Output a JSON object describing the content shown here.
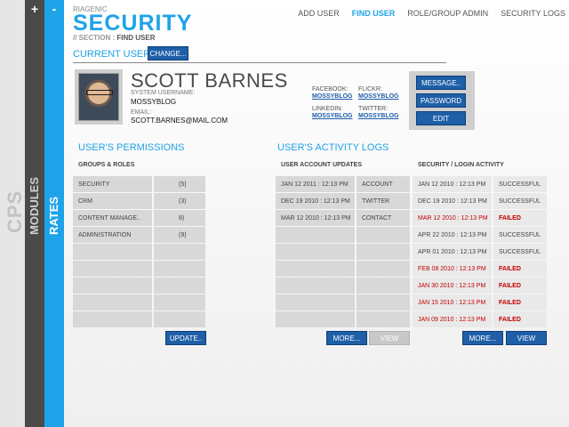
{
  "sidebar": {
    "cps_label": "CPS",
    "modules_label": "MODULES",
    "rates_label": "RATES",
    "plus": "+",
    "minus": "-"
  },
  "header": {
    "brand": "RIAGENIC",
    "title": "SECURITY",
    "breadcrumb_prefix": "// SECTION :",
    "breadcrumb_page": "FIND USER"
  },
  "nav": {
    "items": [
      "ADD USER",
      "FIND USER",
      "ROLE/GROUP ADMIN",
      "SECURITY LOGS"
    ],
    "active": "FIND USER"
  },
  "current_user": {
    "label": "CURRENT USER",
    "change": "CHANGE...",
    "name": "SCOTT BARNES",
    "username_label": "SYSTEM USERNAME:",
    "username": "MOSSYBLOG",
    "email_label": "EMAIL:",
    "email": "SCOTT.BARNES@MAIL.COM",
    "social": {
      "facebook_label": "FACEBOOK:",
      "facebook": "MOSSYBLOG",
      "flickr_label": "FLICKR:",
      "flickr": "MOSSYBLOG",
      "linkedin_label": "LINKEDIN:",
      "linkedin": "MOSSYBLOG",
      "twitter_label": "TWITTER:",
      "twitter": "MOSSYBLOG"
    },
    "actions": [
      "MESSAGE..",
      "PASSWORD",
      "EDIT"
    ]
  },
  "permissions": {
    "title": "USER'S PERMISSIONS",
    "header": "GROUPS & ROLES",
    "rows": [
      {
        "name": "SECURITY",
        "count": "(5)"
      },
      {
        "name": "CRM",
        "count": "(3)"
      },
      {
        "name": "CONTENT MANAGE..",
        "count": "8)"
      },
      {
        "name": "ADMINISTRATION",
        "count": "(9)"
      }
    ],
    "update": "UPDATE.."
  },
  "activity": {
    "title": "USER'S ACTIVITY LOGS",
    "updates_header": "USER ACCOUNT UPDATES",
    "updates": [
      {
        "date": "JAN 12 2011 : 12:13 PM",
        "what": "ACCOUNT"
      },
      {
        "date": "DEC 19 2010 : 12:13 PM",
        "what": "TWITTER"
      },
      {
        "date": "MAR 12 2010 : 12:13 PM",
        "what": "CONTACT"
      }
    ],
    "login_header": "SECURITY / LOGIN ACTIVITY",
    "logins": [
      {
        "date": "JAN 12 2010 : 12:13 PM",
        "status": "SUCCESSFUL",
        "failed": false,
        "date_red": false
      },
      {
        "date": "DEC 19 2010 : 12:13 PM",
        "status": "SUCCESSFUL",
        "failed": false,
        "date_red": false
      },
      {
        "date": "MAR 12 2010 : 12:13 PM",
        "status": "FAILED",
        "failed": true,
        "date_red": true
      },
      {
        "date": "APR 22 2010 : 12:13 PM",
        "status": "SUCCESSFUL",
        "failed": false,
        "date_red": false
      },
      {
        "date": "APR 01 2010 : 12:13 PM",
        "status": "SUCCESSFUL",
        "failed": false,
        "date_red": false
      },
      {
        "date": "FEB 08 2010 : 12:13 PM",
        "status": "FAILED",
        "failed": true,
        "date_red": true
      },
      {
        "date": "JAN 30 2010 : 12:13 PM",
        "status": "FAILED",
        "failed": true,
        "date_red": true
      },
      {
        "date": "JAN 15 2010 : 12:13 PM",
        "status": "FAILED",
        "failed": true,
        "date_red": true
      },
      {
        "date": "JAN 09 2010 : 12:13 PM",
        "status": "FAILED",
        "failed": true,
        "date_red": true
      }
    ],
    "more": "MORE...",
    "view": "VIEW"
  },
  "colors": {
    "accent": "#1fa3e8",
    "button": "#1f5fa8",
    "failed": "#c40000"
  }
}
